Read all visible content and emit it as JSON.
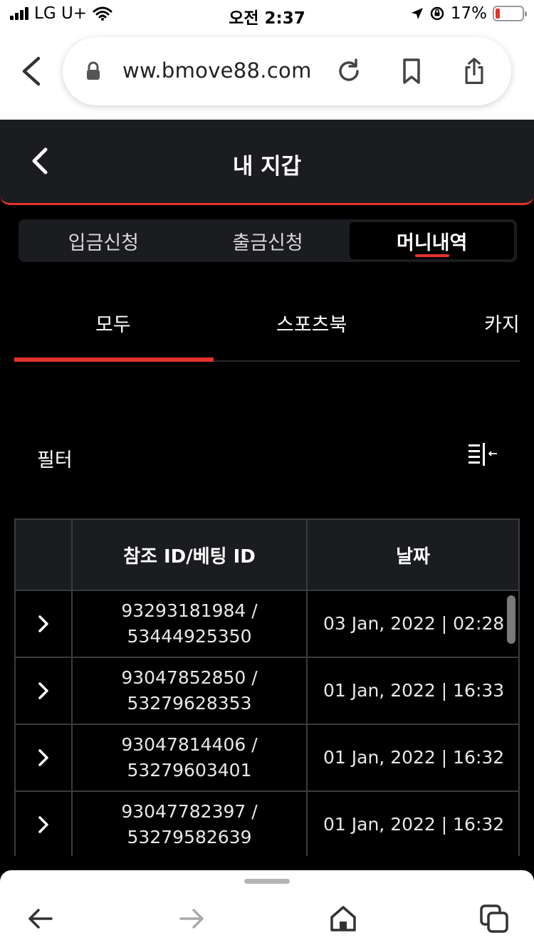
{
  "status_bar": {
    "carrier": "LG U+",
    "time": "오전 2:37",
    "battery_percent": "17%",
    "battery_level": 0.17
  },
  "browser": {
    "url": "ww.bmove88.com"
  },
  "header": {
    "title": "내 지갑"
  },
  "segmented_tabs": [
    {
      "label": "입금신청",
      "active": false
    },
    {
      "label": "출금신청",
      "active": false
    },
    {
      "label": "머니내역",
      "active": true
    }
  ],
  "category_tabs": [
    {
      "label": "모두",
      "active": true
    },
    {
      "label": "스포츠북",
      "active": false
    },
    {
      "label": "카지",
      "active": false
    }
  ],
  "filter": {
    "label": "필터"
  },
  "table": {
    "headers": [
      "",
      "참조 ID/베팅 ID",
      "날짜"
    ],
    "rows": [
      {
        "ref_id": "93293181984 /",
        "bet_id": "53444925350",
        "date": "03 Jan, 2022 | 02:28"
      },
      {
        "ref_id": "93047852850 /",
        "bet_id": "53279628353",
        "date": "01 Jan, 2022 | 16:33"
      },
      {
        "ref_id": "93047814406 /",
        "bet_id": "53279603401",
        "date": "01 Jan, 2022 | 16:32"
      },
      {
        "ref_id": "93047782397 /",
        "bet_id": "53279582639",
        "date": "01 Jan, 2022 | 16:32"
      }
    ]
  },
  "colors": {
    "accent": "#e5322b",
    "panel": "#1b1c1f",
    "background": "#000000"
  }
}
